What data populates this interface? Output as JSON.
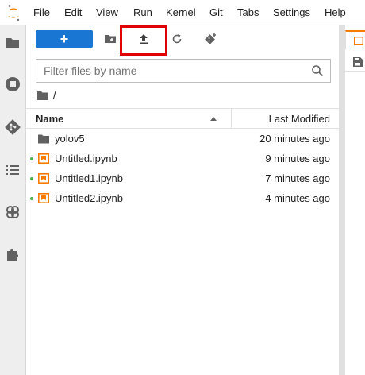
{
  "menubar": {
    "items": [
      "File",
      "Edit",
      "View",
      "Run",
      "Kernel",
      "Git",
      "Tabs",
      "Settings",
      "Help"
    ]
  },
  "activitybar": {
    "icons": [
      "folder-icon",
      "stop-circle-icon",
      "git-icon",
      "list-icon",
      "brain-icon",
      "puzzle-icon"
    ]
  },
  "toolbar": {
    "new_label": "+",
    "icons": [
      "new-folder-icon",
      "upload-icon",
      "refresh-icon",
      "git-clone-icon"
    ]
  },
  "filter": {
    "placeholder": "Filter files by name",
    "value": ""
  },
  "breadcrumb": {
    "path": "/"
  },
  "list": {
    "header_name": "Name",
    "header_modified": "Last Modified",
    "items": [
      {
        "name": "yolov5",
        "modified": "20 minutes ago",
        "type": "folder",
        "running": false
      },
      {
        "name": "Untitled.ipynb",
        "modified": "9 minutes ago",
        "type": "notebook",
        "running": true
      },
      {
        "name": "Untitled1.ipynb",
        "modified": "7 minutes ago",
        "type": "notebook",
        "running": true
      },
      {
        "name": "Untitled2.ipynb",
        "modified": "4 minutes ago",
        "type": "notebook",
        "running": true
      }
    ]
  },
  "colors": {
    "accent": "#1976d2",
    "notebook": "#f57c00",
    "highlight": "#e00000",
    "running": "#4caf50"
  }
}
